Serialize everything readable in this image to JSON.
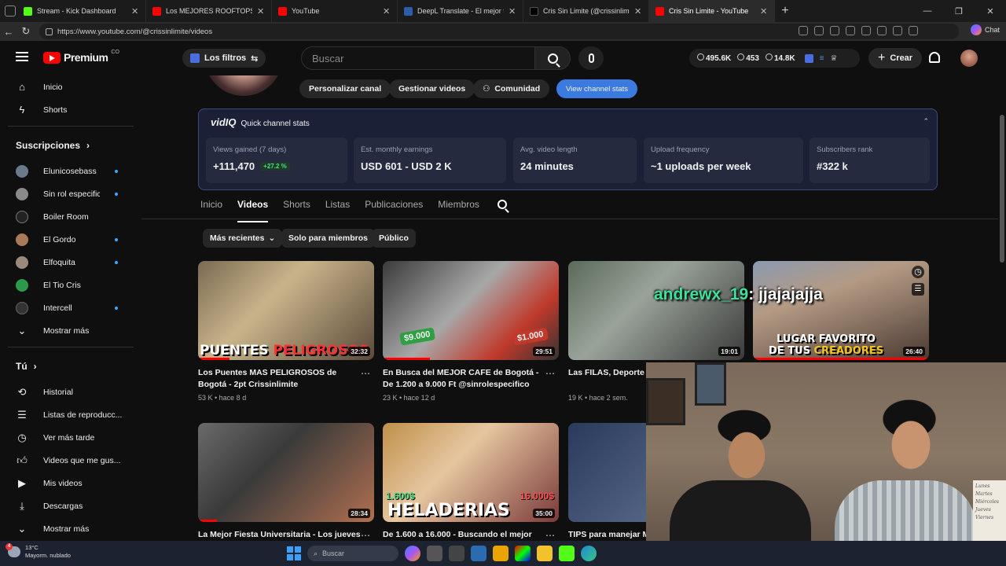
{
  "browser": {
    "tabs": [
      {
        "title": "Stream - Kick Dashboard",
        "color": "#53fc18",
        "active": false
      },
      {
        "title": "Los MEJORES ROOFTOPS de BOGOTÁ",
        "color": "#ff0000",
        "active": false
      },
      {
        "title": "YouTube",
        "color": "#ff0000",
        "active": false
      },
      {
        "title": "DeepL Translate - El mejor traductor",
        "color": "#0f2b46",
        "active": false
      },
      {
        "title": "Cris Sin Limite (@crissinlimite) | TikTok",
        "color": "#111111",
        "active": false
      },
      {
        "title": "Cris Sin Limite - YouTube",
        "color": "#ff0000",
        "active": true
      }
    ],
    "url": "https://www.youtube.com/@crissinlimite/videos",
    "chat_label": "Chat"
  },
  "header": {
    "logo_text": "Premium",
    "logo_sup": "CO",
    "filters_label": "Los filtros",
    "search_placeholder": "Buscar",
    "stats": {
      "views": "495.6K",
      "watching": "453",
      "subs": "14.8K"
    },
    "create_label": "Crear"
  },
  "sidebar": {
    "main": [
      {
        "label": "Inicio",
        "icon": "home-icon"
      },
      {
        "label": "Shorts",
        "icon": "shorts-icon"
      }
    ],
    "subs_title": "Suscripciones",
    "subscriptions": [
      {
        "label": "Elunicosebass",
        "color": "#6b7a8a",
        "dot": true
      },
      {
        "label": "Sin rol especifico",
        "color": "#8a8a8a",
        "dot": true
      },
      {
        "label": "Boiler Room",
        "color": "#222222",
        "dot": false
      },
      {
        "label": "El Gordo",
        "color": "#a87a5a",
        "dot": true
      },
      {
        "label": "Elfoquita",
        "color": "#9a8a7a",
        "dot": true
      },
      {
        "label": "El Tio Cris",
        "color": "#2a9a4a",
        "dot": false
      },
      {
        "label": "Intercell",
        "color": "#333333",
        "dot": true
      }
    ],
    "more_label": "Mostrar más",
    "you_title": "Tú",
    "you_items": [
      {
        "label": "Historial",
        "icon": "history-icon"
      },
      {
        "label": "Listas de reproducc...",
        "icon": "playlist-icon"
      },
      {
        "label": "Ver más tarde",
        "icon": "clock-icon"
      },
      {
        "label": "Videos que me gus...",
        "icon": "like-icon"
      },
      {
        "label": "Mis videos",
        "icon": "my-videos-icon"
      },
      {
        "label": "Descargas",
        "icon": "download-icon"
      },
      {
        "label": "Mostrar más",
        "icon": "chevron-down-icon"
      }
    ]
  },
  "channel": {
    "buttons": [
      "Personalizar canal",
      "Gestionar videos",
      "Comunidad",
      "View channel stats"
    ]
  },
  "vidiq": {
    "brand": "vidIQ",
    "title": "Quick channel stats",
    "cards": [
      {
        "label": "Views gained (7 days)",
        "value": "+111,470",
        "trend": "+27.2 %"
      },
      {
        "label": "Est. monthly earnings",
        "value": "USD 601 - USD 2 K"
      },
      {
        "label": "Avg. video length",
        "value": "24 minutes"
      },
      {
        "label": "Upload frequency",
        "value": "~1 uploads per week"
      },
      {
        "label": "Subscribers rank",
        "value": "#322 k"
      }
    ]
  },
  "channel_tabs": [
    "Inicio",
    "Videos",
    "Shorts",
    "Listas",
    "Publicaciones",
    "Miembros"
  ],
  "chips": [
    "Más recientes",
    "Solo para miembros",
    "Público"
  ],
  "videos": [
    {
      "title": "Los Puentes MAS PELIGROSOS de Bogotá - 2pt Crissinlimite",
      "meta": "53 K • hace 8 d",
      "duration": "32:32",
      "thumb_text": "PUENTES PELIGROSOS",
      "bg": "linear-gradient(135deg,#7a6a52,#c9b48a 40%,#5a4a3a)"
    },
    {
      "title": "En Busca del MEJOR CAFE de Bogotá - De 1.200 a 9.000 Ft @sinrolespecifico",
      "meta": "23 K • hace 12 d",
      "duration": "29:51",
      "thumb_text": "$9.000 · $1.000",
      "bg": "linear-gradient(135deg,#3a3a3a,#a8a8a8 45%,#c0392b 75%,#333)"
    },
    {
      "title": "Las FILAS, Deporte N...",
      "meta": "19 K • hace 2 sem.",
      "duration": "19:01",
      "thumb_text": "",
      "bg": "linear-gradient(135deg,#5a6a5a,#9aa39a 40%,#3a3a3a)"
    },
    {
      "title": "",
      "meta": "",
      "duration": "26:40",
      "thumb_text": "LUGAR FAVORITO DE TUS CREADORES",
      "bg": "linear-gradient(160deg,#8a9ab0,#b49a84 35%,#4a3a32)"
    },
    {
      "title": "La Mejor Fiesta Universitaria - Los jueves de",
      "meta": "",
      "duration": "28:34",
      "thumb_text": "",
      "bg": "linear-gradient(135deg,#6a6a6a,#3a3a3a 40%,#b07050)"
    },
    {
      "title": "De 1.600 a 16.000 - Buscando el mejor",
      "meta": "",
      "duration": "35:00",
      "thumb_text": "HELADERIAS",
      "bg": "linear-gradient(135deg,#c0904a,#e6c6a0 40%,#7a3a3a)"
    },
    {
      "title": "TIPS para manejar M...",
      "meta": "",
      "duration": "",
      "thumb_text": "",
      "bg": "linear-gradient(135deg,#2a3a5a,#6a7a9a)"
    }
  ],
  "overlay_chat": {
    "user": "andrewx_19",
    "message": ": jjajajajja"
  },
  "webcam_note": "Lunes Martes Miércoles Jueves Viernes",
  "taskbar": {
    "temp": "13°C",
    "weather": "Mayorm. nublado",
    "badge": "4",
    "search_placeholder": "Buscar"
  }
}
